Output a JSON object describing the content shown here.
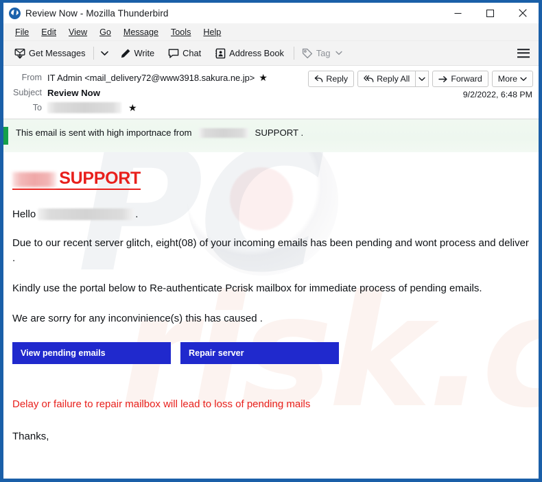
{
  "window": {
    "title": "Review Now - Mozilla Thunderbird",
    "app_icon": "thunderbird-icon",
    "controls": {
      "minimize": "minimize-icon",
      "maximize": "maximize-icon",
      "close": "close-icon"
    }
  },
  "menubar": {
    "items": [
      {
        "label": "File",
        "accel": "F"
      },
      {
        "label": "Edit",
        "accel": "E"
      },
      {
        "label": "View",
        "accel": "V"
      },
      {
        "label": "Go",
        "accel": "G"
      },
      {
        "label": "Message",
        "accel": "M"
      },
      {
        "label": "Tools",
        "accel": "T"
      },
      {
        "label": "Help",
        "accel": "H"
      }
    ]
  },
  "toolbar": {
    "get_messages": "Get Messages",
    "write": "Write",
    "chat": "Chat",
    "address_book": "Address Book",
    "tag": "Tag",
    "app_menu": "hamburger-icon"
  },
  "header": {
    "from_label": "From",
    "from_value": "IT Admin <mail_delivery72@www3918.sakura.ne.jp>",
    "subject_label": "Subject",
    "subject_value": "Review Now",
    "to_label": "To",
    "to_value_redacted": true,
    "date": "9/2/2022, 6:48 PM",
    "actions": {
      "reply": "Reply",
      "reply_all": "Reply All",
      "forward": "Forward",
      "more": "More"
    }
  },
  "message": {
    "banner": {
      "text_before": "This email is sent with high importnace from",
      "redacted": true,
      "text_after": "SUPPORT ."
    },
    "brand_heading": {
      "redacted_logo": true,
      "word": "SUPPORT"
    },
    "greeting_prefix": "Hello",
    "greeting_redacted": true,
    "greeting_suffix": ".",
    "paragraph_1": "Due to our recent server glitch, eight(08) of your incoming emails has been pending and wont process and deliver .",
    "paragraph_2": "Kindly use the portal below to Re-authenticate Pcrisk mailbox for immediate process of pending emails.",
    "paragraph_3": "We are sorry for any inconvinience(s) this has caused .",
    "cta_primary": "View pending emails",
    "cta_secondary": "Repair server",
    "warning": "Delay or failure to repair mailbox will lead to loss of pending mails",
    "closing": "Thanks,",
    "signature_redacted": true,
    "signature_suffix": "."
  },
  "watermark": {
    "part_1": "PC",
    "part_2": "risk.com"
  },
  "colors": {
    "window_border": "#1a5fa8",
    "banner_bar": "#16a04b",
    "banner_bg": "#eef7ef",
    "brand_red": "#e8201c",
    "cta_blue": "#2029cd",
    "toolbar_bg": "#f3f3f3"
  }
}
